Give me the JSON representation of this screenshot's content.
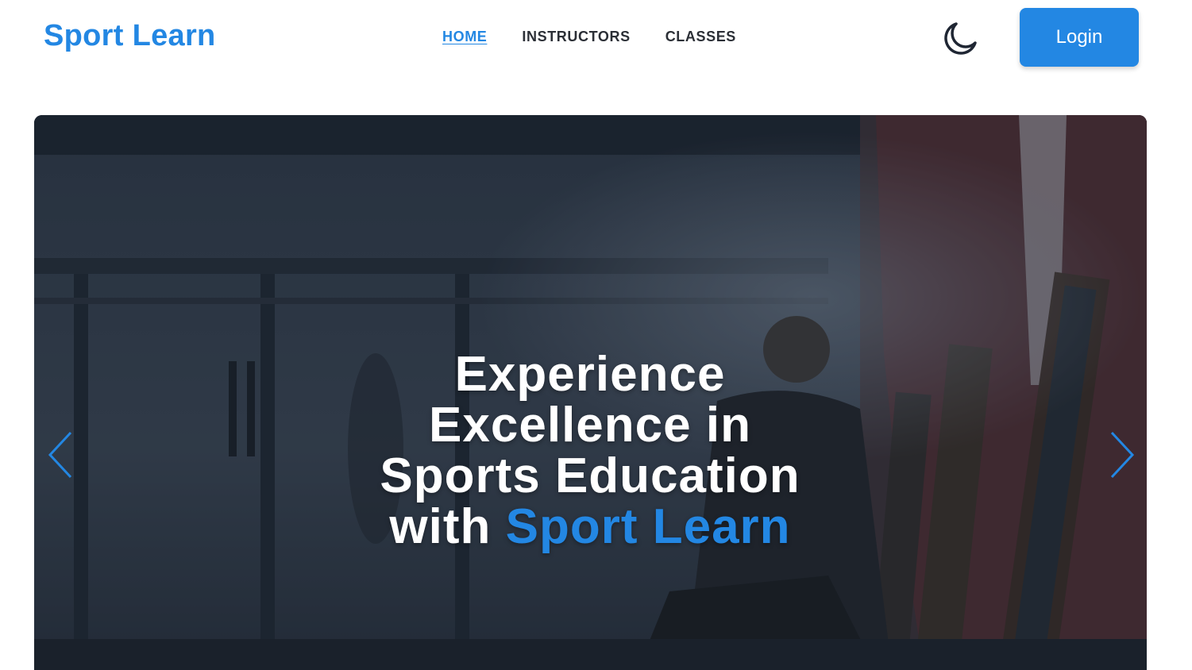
{
  "header": {
    "logo": "Sport Learn",
    "nav": [
      {
        "label": "HOME",
        "active": true
      },
      {
        "label": "INSTRUCTORS",
        "active": false
      },
      {
        "label": "CLASSES",
        "active": false
      }
    ],
    "theme_icon": "moon-icon",
    "login_label": "Login"
  },
  "hero": {
    "title_line1": "Experience",
    "title_line2": "Excellence in",
    "title_line3": "Sports Education",
    "title_with": "with ",
    "title_accent": "Sport Learn",
    "prev_icon": "chevron-left-icon",
    "next_icon": "chevron-right-icon"
  },
  "colors": {
    "accent": "#2387e3",
    "nav_text": "#2b2f36",
    "hero_overlay": "#1c2432"
  }
}
